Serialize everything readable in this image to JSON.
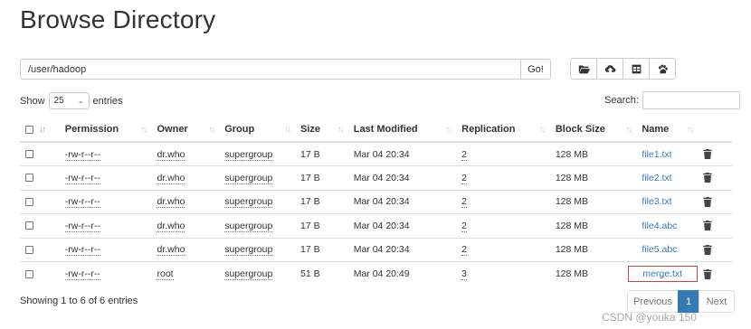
{
  "page_title": "Browse Directory",
  "path_bar": {
    "value": "/user/hadoop",
    "go_label": "Go!"
  },
  "toolbar": {
    "buttons": [
      "folder-open-icon",
      "upload-cloud-icon",
      "table-icon",
      "paw-icon"
    ]
  },
  "length": {
    "show_label": "Show",
    "selected": "25",
    "entries_label": "entries"
  },
  "search": {
    "label": "Search:",
    "value": ""
  },
  "table": {
    "headers": {
      "permission": "Permission",
      "owner": "Owner",
      "group": "Group",
      "size": "Size",
      "last_modified": "Last Modified",
      "replication": "Replication",
      "block_size": "Block Size",
      "name": "Name"
    },
    "rows": [
      {
        "permission": "-rw-r--r--",
        "owner": "dr.who",
        "group": "supergroup",
        "size": "17 B",
        "last_modified": "Mar 04 20:34",
        "replication": "2",
        "block_size": "128 MB",
        "name": "file1.txt"
      },
      {
        "permission": "-rw-r--r--",
        "owner": "dr.who",
        "group": "supergroup",
        "size": "17 B",
        "last_modified": "Mar 04 20:34",
        "replication": "2",
        "block_size": "128 MB",
        "name": "file2.txt"
      },
      {
        "permission": "-rw-r--r--",
        "owner": "dr.who",
        "group": "supergroup",
        "size": "17 B",
        "last_modified": "Mar 04 20:34",
        "replication": "2",
        "block_size": "128 MB",
        "name": "file3.txt"
      },
      {
        "permission": "-rw-r--r--",
        "owner": "dr.who",
        "group": "supergroup",
        "size": "17 B",
        "last_modified": "Mar 04 20:34",
        "replication": "2",
        "block_size": "128 MB",
        "name": "file4.abc"
      },
      {
        "permission": "-rw-r--r--",
        "owner": "dr.who",
        "group": "supergroup",
        "size": "17 B",
        "last_modified": "Mar 04 20:34",
        "replication": "2",
        "block_size": "128 MB",
        "name": "file5.abc"
      },
      {
        "permission": "-rw-r--r--",
        "owner": "root",
        "group": "supergroup",
        "size": "51 B",
        "last_modified": "Mar 04 20:49",
        "replication": "3",
        "block_size": "128 MB",
        "name": "merge.txt"
      }
    ]
  },
  "status": "Showing 1 to 6 of 6 entries",
  "pagination": {
    "previous": "Previous",
    "current": "1",
    "next": "Next"
  },
  "watermark": "CSDN @youka 150",
  "colors": {
    "link": "#337ab7",
    "active_page": "#337ab7",
    "highlight_border": "#c9473f"
  }
}
